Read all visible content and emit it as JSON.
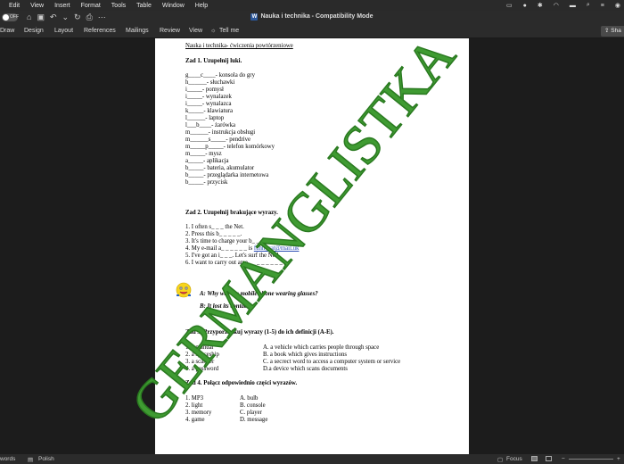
{
  "menubar": {
    "items": [
      "Edit",
      "View",
      "Insert",
      "Format",
      "Tools",
      "Table",
      "Window",
      "Help"
    ]
  },
  "titlebar": {
    "autosave_state": "OFF",
    "title": "Nauka i technika  -  Compatibility Mode"
  },
  "ribbon": {
    "tabs": [
      "Draw",
      "Design",
      "Layout",
      "References",
      "Mailings",
      "Review",
      "View"
    ],
    "tell_me": "Tell me",
    "share": "Sha"
  },
  "doc": {
    "heading": "Nauka i technika- ćwiczenia powtórzeniowe",
    "zad1_title": "Zad 1. Uzupełnij luki.",
    "zad1_lines": [
      "g____c____- konsola do gry",
      "h______- słuchawki",
      "i_____- pomysł",
      "i_____- wynalazek",
      "i_____- wynalazca",
      "k_____- klawiatura",
      "l______- laptop",
      "l___b____- żarówka",
      "m______- instrukcja obsługi",
      "m______s_____- pendrive",
      "m_____p_____- telefon komórkowy",
      "m_____- mysz",
      "a_____- aplikacja",
      "b_____- bateria, akumulator",
      "b_____- przeglądarka internetowa",
      "b_____- przycisk"
    ],
    "zad2_title": "Zad 2. Uzupełnij brakujące wyrazy.",
    "zad2_lines": [
      "1. I often s_ _ _ the Net.",
      "2. Press this b_ _ _ _ _.",
      "3. It's time to charge your b_ _ _ _ _ _ _ .",
      "4. My e-mail a_ _ _ _ _ _ is",
      "5. I've got an i_ _ _. Let's surf the Net!",
      "6. I want to carry out an e_ _ _ _ _ _ _ _ _."
    ],
    "zad2_email": "funnycat@mail.uk",
    "joke_a": "A: Why was the mobile phone wearing glasses?",
    "joke_b": "B: It lost its contacts.",
    "zad3_title": "Zad 3. Przyporządkuj wyrazy (1-5) do ich definicji (A-E).",
    "zad3_left": [
      "1. a manual",
      "2. a spaceship",
      "3. a scanner",
      "4. a password"
    ],
    "zad3_right": [
      "A. a vehicle which carries people through space",
      "B. a book which gives instructions",
      "C. a secrect word to access a computer system or service",
      "D.a device which scans documents"
    ],
    "zad4_title": "Zad 4. Połącz odpowiednio części wyrazów.",
    "zad4_left": [
      "1. MP3",
      "2. light",
      "3. memory",
      "4. game"
    ],
    "zad4_right": [
      "A. bulb",
      "B. console",
      "C. player",
      "D. message"
    ]
  },
  "watermark": {
    "text": "GERMANGLISTKA",
    "color": "#3f9b32"
  },
  "statusbar": {
    "words": "words",
    "language": "Polish",
    "focus": "Focus"
  },
  "colors": {
    "chrome_bg": "#2b2b2b",
    "doc_bg": "#1c1c1c",
    "page_bg": "#ffffff",
    "link": "#2d4fb5"
  }
}
